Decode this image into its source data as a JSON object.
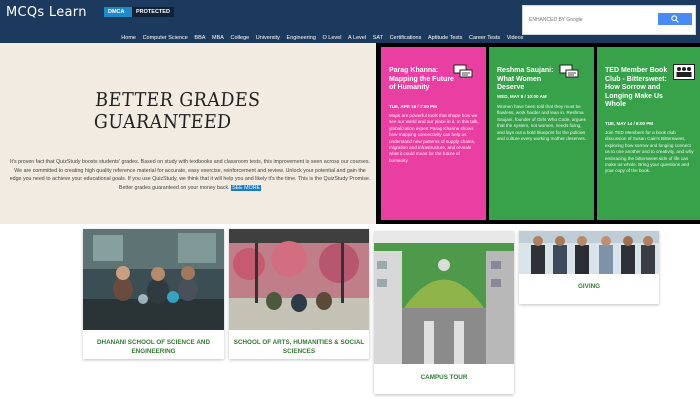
{
  "header": {
    "logo": "MCQs Learn",
    "badge_dmca": "DMCA",
    "badge_protected": "PROTECTED",
    "search_placeholder": "ENHANCED BY Google",
    "nav": [
      "Home",
      "Computer Science",
      "BBA",
      "MBA",
      "College",
      "University",
      "Engineering",
      "O Level",
      "A Level",
      "SAT",
      "Certifications",
      "Aptitude Tests",
      "Career Tests",
      "Videos"
    ]
  },
  "hero": {
    "title": "BETTER GRADES GUARANTEED",
    "text": "It's proven fact that QuizStudy boosts students' grades. Based on study with textbooks and classroom tests, this improvement is seen across our courses. We are committed to creating high quality reference material for accurate, easy exercise, reinforcement and review. Unlock your potential and gain the edge you need to achieve your educational goals. If you use QuizStudy, we think that it will help you and likely it's the time. This is the QuizStudy Promise. Better grades guaranteed on your money back.",
    "link": "SEE MORE"
  },
  "events": [
    {
      "title": "Parag Khanna: Mapping the Future of Humanity",
      "date": "TUE, APR 16 / 7:00 PM",
      "desc": "Maps are powerful tools that shape how we see our world and our place in it. In this talk, globalization expert Parag Khanna shows how mapping connectivity can help us understand new patterns of supply chains, migration and infrastructure, and reveals what it could mean for the future of humanity."
    },
    {
      "title": "Reshma Saujani: What Women Deserve",
      "date": "WED, MAY 8 / 10:00 AM",
      "desc": "Women have been told that they must be flawless, work harder and lean in. Reshma Saujani, founder of Girls Who Code, argues that the system, not women, needs fixing, and lays out a bold blueprint for the policies and culture every working mother deserves."
    },
    {
      "title": "TED Member Book Club - Bittersweet: How Sorrow and Longing Make Us Whole",
      "date": "TUE, MAY 14 / 6:00 PM",
      "desc": "Join TED Members for a book club discussion of Susan Cain's Bittersweet, exploring how sorrow and longing connect us to one another and to creativity, and why embracing the bittersweet side of life can make us whole. Bring your questions and your copy of the book."
    }
  ],
  "cards": [
    {
      "label": "DHANANI SCHOOL OF SCIENCE AND ENGINEERING"
    },
    {
      "label": "SCHOOL OF ARTS, HUMANITIES & SOCIAL SCIENCES"
    },
    {
      "label": "CAMPUS TOUR"
    },
    {
      "label": "GIVING"
    }
  ],
  "colors": {
    "header": "#1c3a5e",
    "pink": "#ea3fa2",
    "green": "#37a24a",
    "card_label": "#2f7a2f"
  },
  "icons": [
    "search-icon",
    "chat-bubble-icon",
    "group-icon"
  ]
}
